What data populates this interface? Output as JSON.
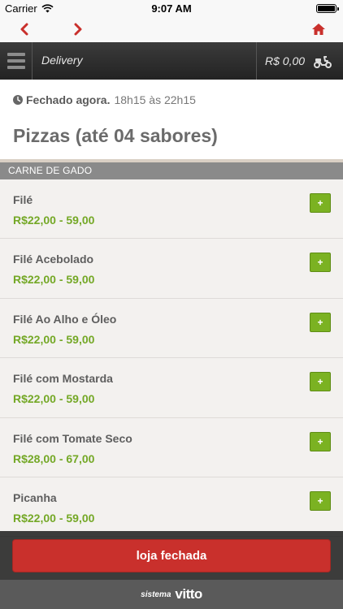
{
  "status_bar": {
    "carrier": "Carrier",
    "time": "9:07 AM"
  },
  "header": {
    "title": "Delivery",
    "cart_total": "R$ 0,00"
  },
  "store": {
    "status": "Fechado agora.",
    "hours": "18h15 às 22h15",
    "category_title": "Pizzas (até 04 sabores)"
  },
  "section": {
    "title": "CARNE DE GADO"
  },
  "products": [
    {
      "name": "Filé",
      "price": "R$22,00 - 59,00",
      "add_label": "+"
    },
    {
      "name": "Filé Acebolado",
      "price": "R$22,00 - 59,00",
      "add_label": "+"
    },
    {
      "name": "Filé Ao Alho e Óleo",
      "price": "R$22,00 - 59,00",
      "add_label": "+"
    },
    {
      "name": "Filé com Mostarda",
      "price": "R$22,00 - 59,00",
      "add_label": "+"
    },
    {
      "name": "Filé com Tomate Seco",
      "price": "R$28,00 - 67,00",
      "add_label": "+"
    },
    {
      "name": "Picanha",
      "price": "R$22,00 - 59,00",
      "add_label": "+"
    }
  ],
  "footer": {
    "closed_label": "loja fechada",
    "brand_prefix": "sistema",
    "brand_name": "vitto"
  },
  "icons": {
    "back": "chevron-left-icon",
    "forward": "chevron-right-icon",
    "home": "home-icon",
    "menu": "hamburger-menu-icon",
    "delivery": "scooter-icon",
    "clock": "clock-icon",
    "wifi": "wifi-icon",
    "battery": "battery-icon"
  },
  "colors": {
    "accent_red": "#c9302c",
    "price_green": "#74a826",
    "add_button_green": "#7bb222",
    "header_dark": "#2e2e2e",
    "section_gray": "#8a8a8a"
  }
}
